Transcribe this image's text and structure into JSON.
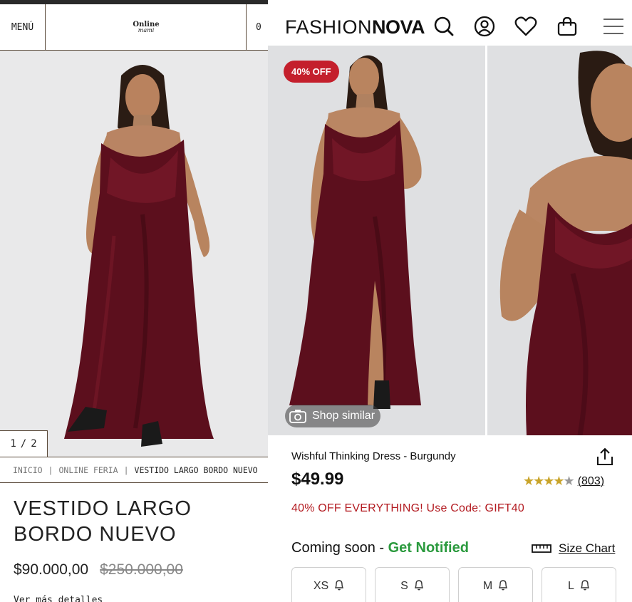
{
  "left": {
    "menu_label": "MENÚ",
    "logo_top": "Online",
    "logo_bottom": "mami",
    "cart_count": "0",
    "counter": {
      "current": "1",
      "sep": "/",
      "total": "2"
    },
    "breadcrumb": {
      "home": "INICIO",
      "category": "ONLINE FERIA",
      "current": "VESTIDO LARGO BORDO NUEVO",
      "sep": "|"
    },
    "title": "VESTIDO LARGO BORDO NUEVO",
    "price": "$90.000,00",
    "old_price": "$250.000,00",
    "more_link": "Ver más detalles"
  },
  "right": {
    "brand_light": "FASHION",
    "brand_bold": "NOVA",
    "header_icons": [
      "search-icon",
      "account-icon",
      "heart-icon",
      "bag-icon",
      "hamburger-menu-icon"
    ],
    "badge": "40% OFF",
    "shop_similar": "Shop similar",
    "product_name": "Wishful Thinking Dress - Burgundy",
    "price": "$49.99",
    "rating": 4,
    "review_count": "(803)",
    "promo": "40% OFF EVERYTHING! Use Code: GIFT40",
    "coming_soon": "Coming soon",
    "dash": " - ",
    "get_notified": "Get Notified",
    "size_chart": "Size Chart",
    "sizes": [
      "XS",
      "S",
      "M",
      "L"
    ],
    "colors": {
      "badge": "#c41f2c",
      "promo": "#b31b21",
      "notify": "#2b9a3e",
      "dress": "#5c0f1d",
      "star": "#c9a42a"
    }
  }
}
